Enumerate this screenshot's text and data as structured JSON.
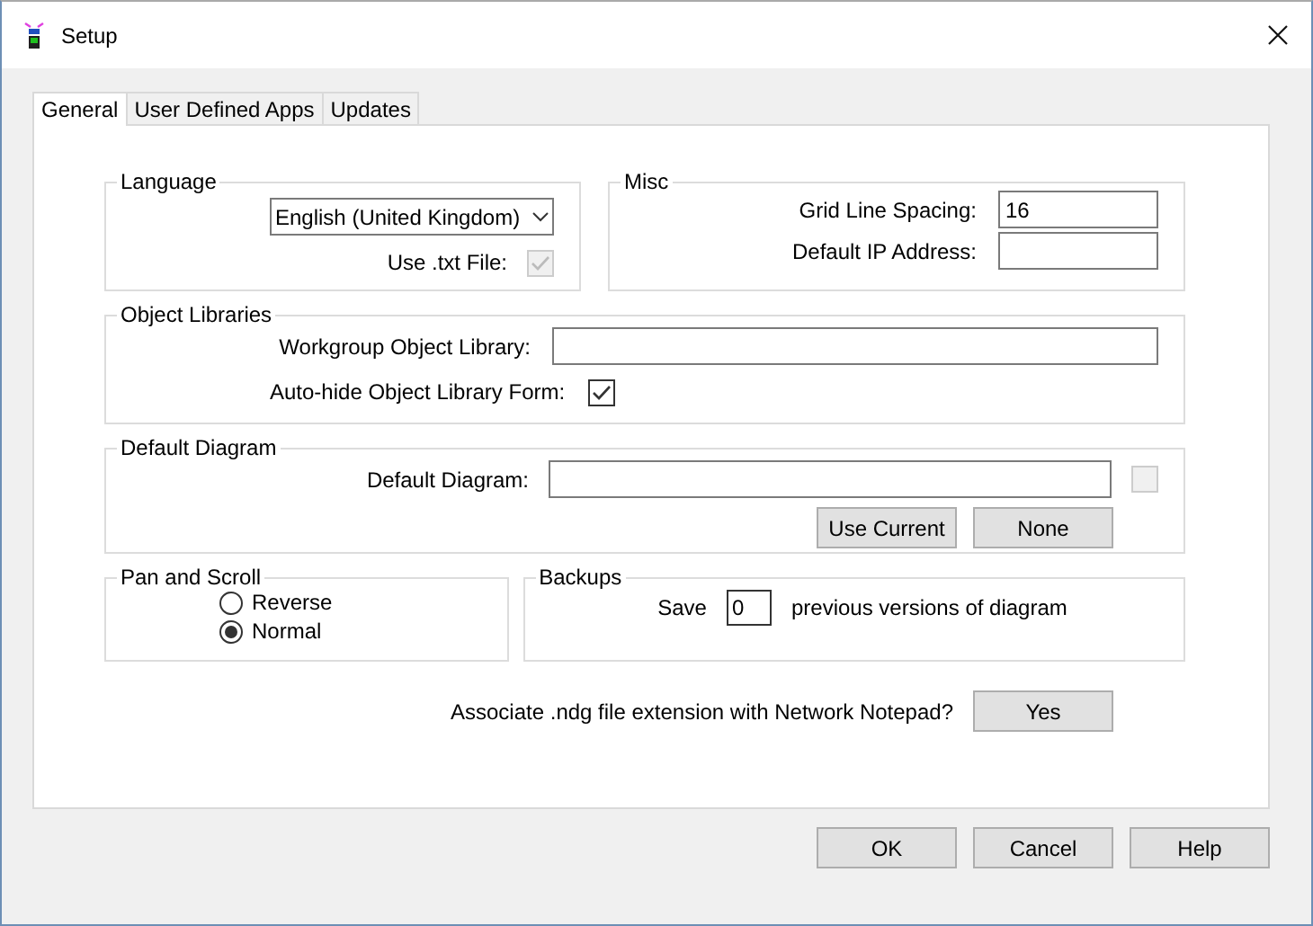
{
  "window": {
    "title": "Setup"
  },
  "tabs": [
    {
      "label": "General",
      "selected": true
    },
    {
      "label": "User Defined Apps",
      "selected": false
    },
    {
      "label": "Updates",
      "selected": false
    }
  ],
  "language": {
    "title": "Language",
    "dropdown": "English (United Kingdom)",
    "use_txt_label": "Use .txt File:",
    "use_txt_checked": true,
    "use_txt_disabled": true
  },
  "misc": {
    "title": "Misc",
    "fields": [
      {
        "label": "Grid Line Spacing:",
        "value": "16"
      },
      {
        "label": "Default IP Address:"
      }
    ]
  },
  "object_libraries": {
    "title": "Object Libraries",
    "library_label": "Workgroup Object Library:",
    "autohide_label": "Auto-hide Object Library Form:",
    "autohide_checked": true
  },
  "default_diagram": {
    "title": "Default Diagram",
    "label": "Default Diagram:",
    "checkbox_checked": false,
    "checkbox_disabled": true,
    "buttons": [
      "Use Current",
      "None"
    ]
  },
  "pan_and_scroll": {
    "title": "Pan and Scroll",
    "options": [
      {
        "label": "Reverse",
        "selected": false
      },
      {
        "label": "Normal",
        "selected": true
      }
    ]
  },
  "backups": {
    "title": "Backups",
    "before": "Save",
    "value": "0",
    "after": "previous versions of diagram"
  },
  "associate": {
    "question": "Associate .ndg file extension with Network Notepad?",
    "button": "Yes"
  },
  "buttons": [
    "OK",
    "Cancel",
    "Help"
  ]
}
